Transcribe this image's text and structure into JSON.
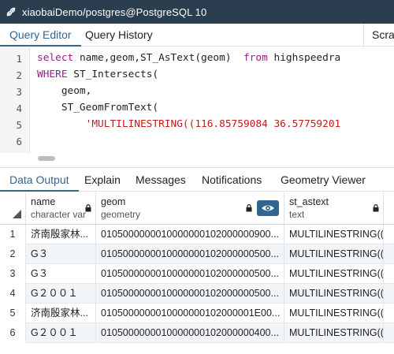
{
  "window": {
    "title": "xiaobaiDemo/postgres@PostgreSQL 10"
  },
  "editor_tabs": {
    "query_editor": "Query Editor",
    "query_history": "Query History",
    "scratch": "Scra"
  },
  "editor": {
    "line_numbers": [
      "1",
      "2",
      "3",
      "4",
      "5",
      "6"
    ],
    "lines": {
      "l1_kw1": "select",
      "l1_rest": " name,geom,ST_AsText(geom)  ",
      "l1_kw2": "from",
      "l1_tail": " highspeedra",
      "l2_kw": "WHERE",
      "l2_rest": " ST_Intersects(",
      "l3": "    geom,",
      "l4": "    ST_GeomFromText(",
      "l5_indent": "        ",
      "l5_str": "'MULTILINESTRING((116.85759084 36.57759201"
    }
  },
  "output_tabs": {
    "data_output": "Data Output",
    "explain": "Explain",
    "messages": "Messages",
    "notifications": "Notifications",
    "geometry_viewer": "Geometry Viewer"
  },
  "grid": {
    "columns": [
      {
        "name": "name",
        "type": "character varyin"
      },
      {
        "name": "geom",
        "type": "geometry"
      },
      {
        "name": "st_astext",
        "type": "text"
      }
    ],
    "rows": [
      {
        "n": "1",
        "name": "济南殷家林...",
        "geom": "0105000000010000000102000000900...",
        "st_astext": "MULTILINESTRING(("
      },
      {
        "n": "2",
        "name": "G３",
        "geom": "0105000000010000000102000000500...",
        "st_astext": "MULTILINESTRING(("
      },
      {
        "n": "3",
        "name": "G３",
        "geom": "0105000000010000000102000000500...",
        "st_astext": "MULTILINESTRING(("
      },
      {
        "n": "4",
        "name": "G２００１",
        "geom": "0105000000010000000102000000500...",
        "st_astext": "MULTILINESTRING(("
      },
      {
        "n": "5",
        "name": "济南殷家林...",
        "geom": "0105000000010000000102000001E00...",
        "st_astext": "MULTILINESTRING(("
      },
      {
        "n": "6",
        "name": "G２００１",
        "geom": "0105000000010000000102000000400...",
        "st_astext": "MULTILINESTRING(("
      }
    ]
  },
  "colors": {
    "titlebar": "#2b3e50",
    "accent": "#326690",
    "keyword": "#9a1c88",
    "string": "#c41a16"
  }
}
